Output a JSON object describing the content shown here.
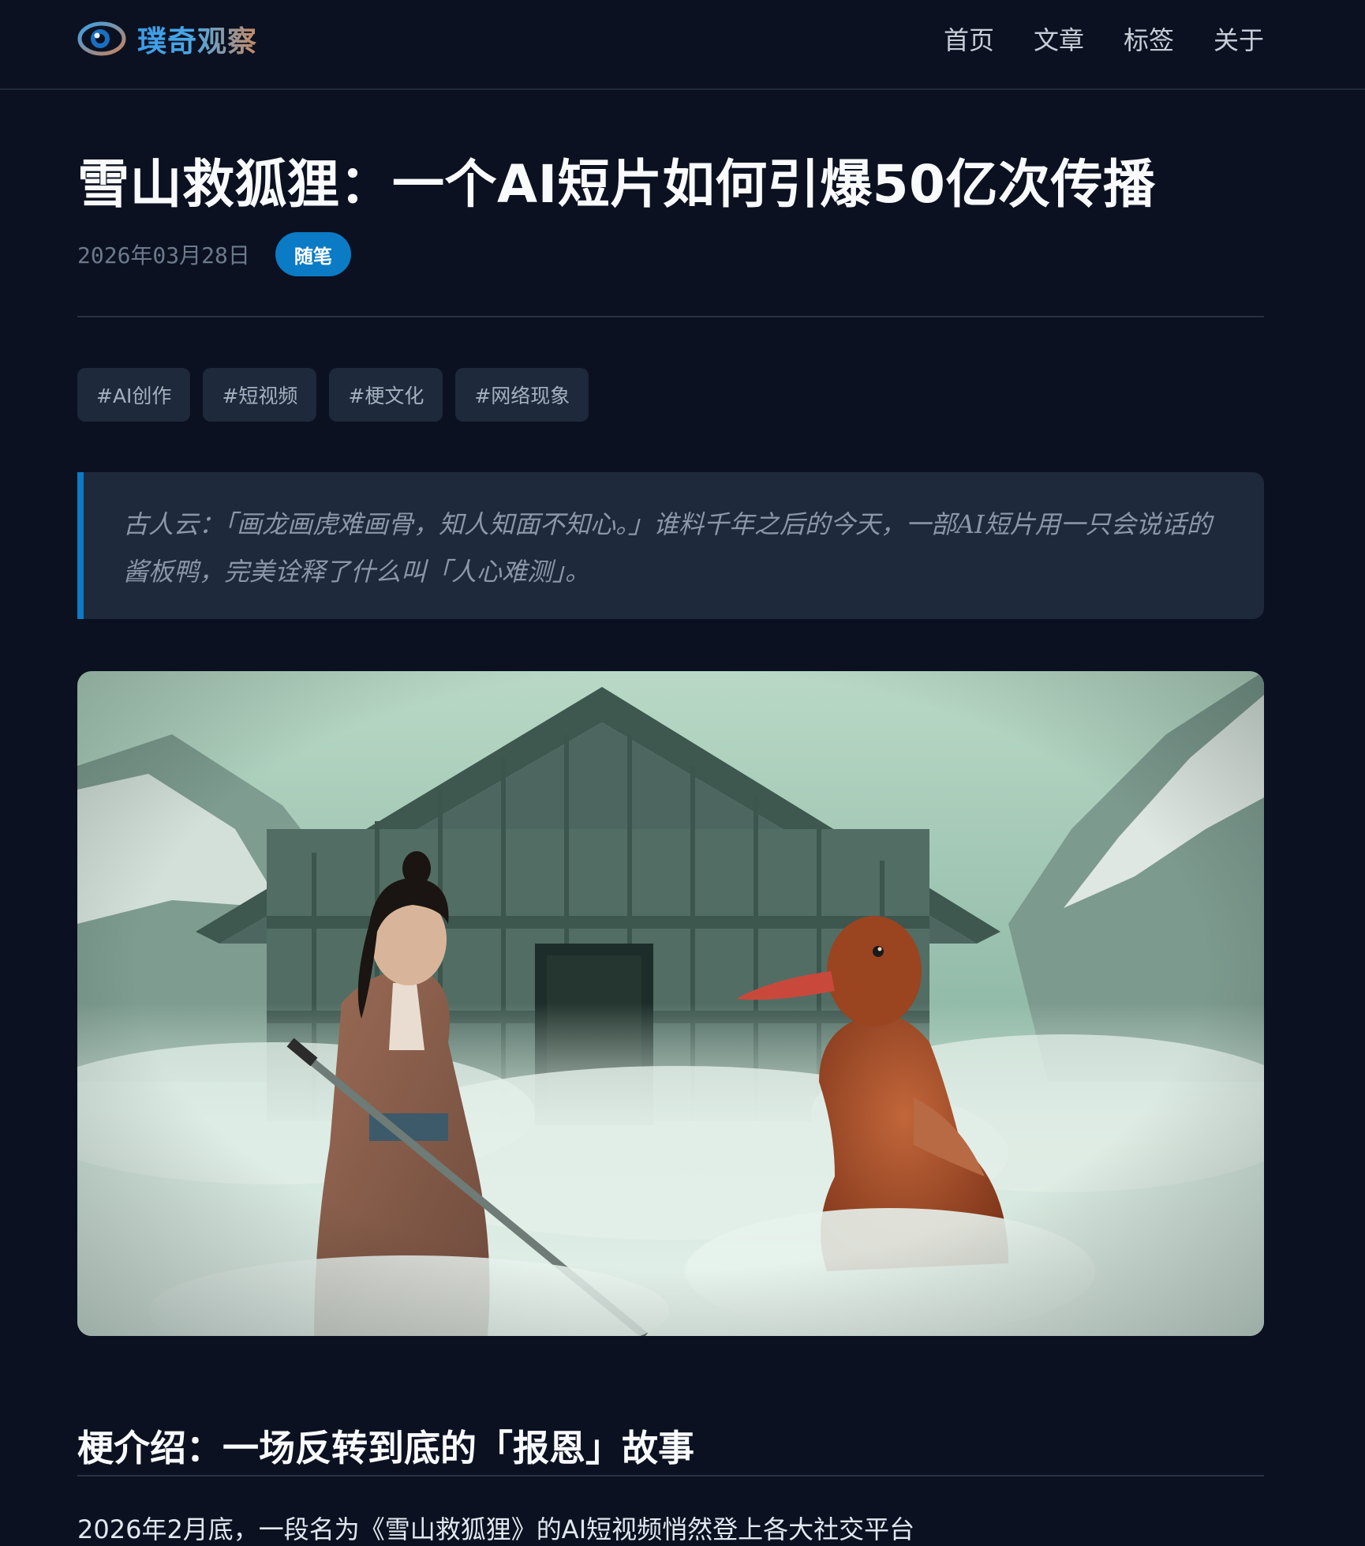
{
  "site": {
    "name": "璞奇观察",
    "logo_icon": "eye-logo-icon"
  },
  "nav": {
    "items": [
      {
        "label": "首页"
      },
      {
        "label": "文章"
      },
      {
        "label": "标签"
      },
      {
        "label": "关于"
      }
    ]
  },
  "article": {
    "title": "雪山救狐狸：一个AI短片如何引爆50亿次传播",
    "date": "2026年03月28日",
    "category": "随笔",
    "tags": [
      "#AI创作",
      "#短视频",
      "#梗文化",
      "#网络现象"
    ],
    "quote": "古人云：「画龙画虎难画骨，知人知面不知心。」谁料千年之后的今天，一部AI短片用一只会说话的酱板鸭，完美诠释了什么叫「人心难测」。",
    "hero_image": "still-swordsman-and-roast-duck-before-snowy-cabin",
    "section_heading": "梗介绍：一场反转到底的「报恩」故事",
    "paragraph": "2026年2月底，一段名为《雪山救狐狸》的AI短视频悄然登上各大社交平台"
  },
  "colors": {
    "background": "#0b1120",
    "accent": "#0a7bc4",
    "tag_background": "#1e293b",
    "muted_text": "#6b7a8d"
  }
}
